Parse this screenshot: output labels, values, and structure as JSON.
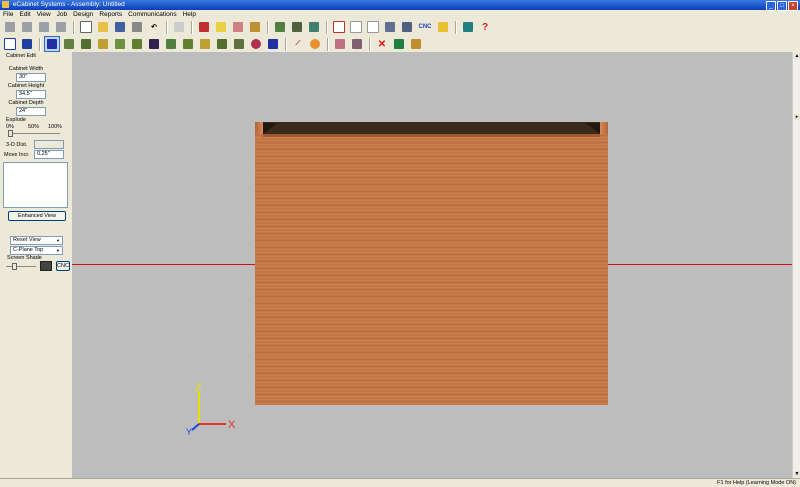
{
  "window": {
    "title": "eCabinet Systems - Assembly: Untitled"
  },
  "menu": [
    "File",
    "Edit",
    "View",
    "Job",
    "Design",
    "Reports",
    "Communications",
    "Help"
  ],
  "toolbar": {
    "cnc_label": "CNC",
    "help_label": "?",
    "delete_label": "✕"
  },
  "panel": {
    "heading": "Cabinet Edit",
    "width_label": "Cabinet Width",
    "width_value": "30\"",
    "height_label": "Cabinet Height",
    "height_value": "34.5\"",
    "depth_label": "Cabinet Depth",
    "depth_value": "24\"",
    "explode_label": "Explode",
    "explode_ticks": [
      "0%",
      "50%",
      "100%"
    ],
    "explode_fraction": 0.0,
    "dist_label": "3-D Dist.",
    "dist_value": "",
    "move_label": "Move Incr.",
    "move_value": "0.25\"",
    "enhanced_view": "Enhanced View",
    "reset_view": "Reset View",
    "cplane": "C-Plane Top",
    "screen_shade": "Screen Shade",
    "cnc": "CNC"
  },
  "axes": {
    "z": "Z",
    "y": "Y",
    "x": "X"
  },
  "status": {
    "help_text": "F1 for Help (Learning Mode ON)"
  },
  "colors": {
    "title_bar": "#0a3fb8",
    "viewport": "#bdbdbd",
    "wood": "#c8784a",
    "axis_x": "#e03030",
    "axis_y": "#2040e0",
    "axis_z": "#e8e000"
  }
}
